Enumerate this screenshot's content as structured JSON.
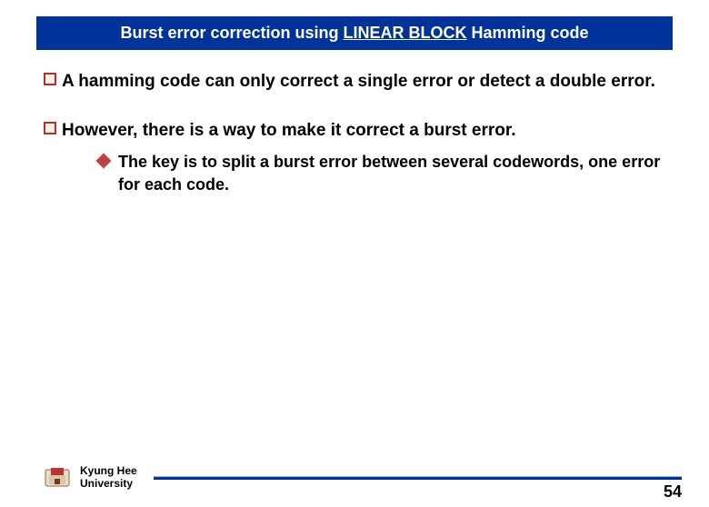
{
  "title": {
    "pre": "Burst error correction using ",
    "underlined": "LINEAR BLOCK",
    "post": " Hamming code"
  },
  "bullets": [
    {
      "text": "A hamming code can only correct a single error or detect a double error."
    },
    {
      "text": "However, there is a way to make it correct a burst error.",
      "sub": {
        "text": "The key is to split a burst error between several codewords, one error for each code."
      }
    }
  ],
  "footer": {
    "university_line1": "Kyung Hee",
    "university_line2": "University",
    "page": "54"
  }
}
